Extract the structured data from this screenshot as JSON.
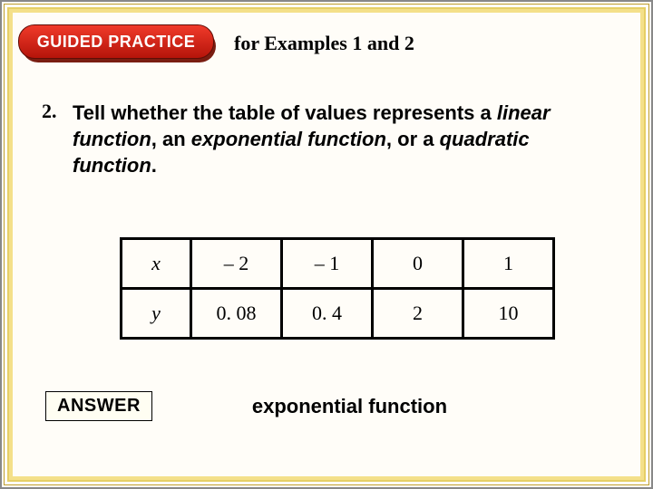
{
  "header": {
    "badge": "GUIDED PRACTICE",
    "subtitle": "for Examples 1 and 2"
  },
  "question": {
    "number": "2.",
    "text_pre": "Tell whether the table of values represents a ",
    "em1": "linear function",
    "mid1": ", an ",
    "em2": "exponential function",
    "mid2": ", or a ",
    "em3": "quadratic function",
    "post": "."
  },
  "table": {
    "row_labels": [
      "x",
      "y"
    ],
    "cols": [
      "– 2",
      "– 1",
      "0",
      "1"
    ],
    "yvals": [
      "0. 08",
      "0. 4",
      "2",
      "10"
    ]
  },
  "answer": {
    "label": "ANSWER",
    "text": "exponential function"
  },
  "chart_data": {
    "type": "table",
    "title": "Function values table",
    "columns": [
      "x",
      "y"
    ],
    "rows": [
      {
        "x": -2,
        "y": 0.08
      },
      {
        "x": -1,
        "y": 0.4
      },
      {
        "x": 0,
        "y": 2
      },
      {
        "x": 1,
        "y": 10
      }
    ]
  }
}
